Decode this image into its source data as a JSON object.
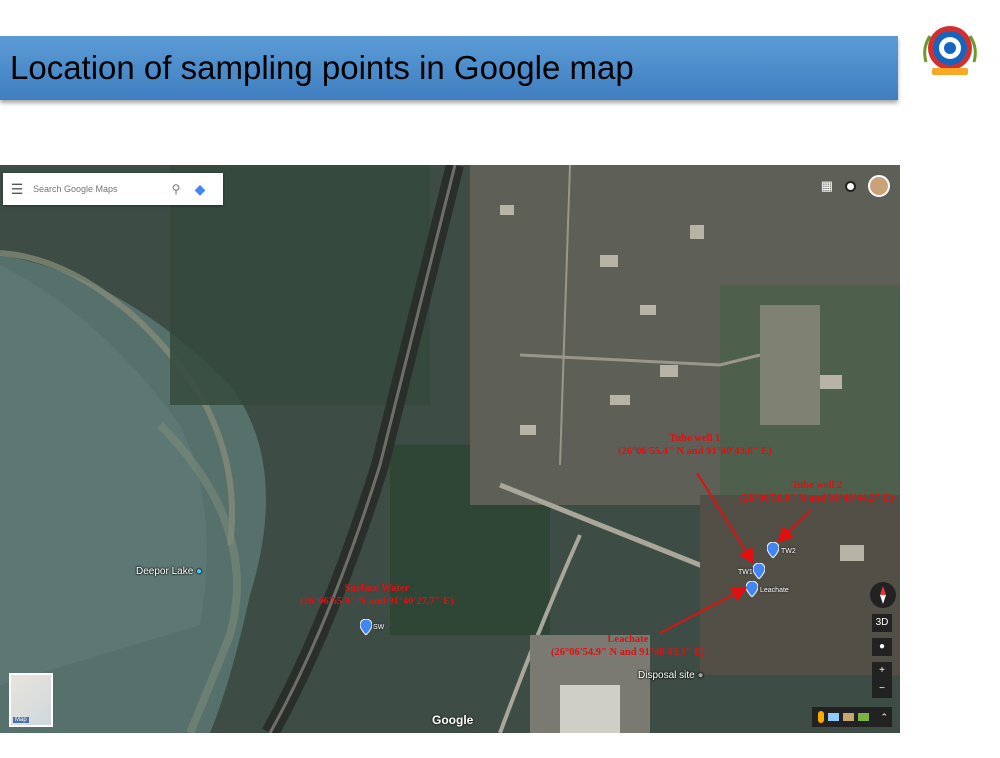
{
  "slide": {
    "title": "Location of sampling points in Google map"
  },
  "map": {
    "search": {
      "placeholder": "Search Google Maps"
    },
    "places": {
      "lake": "Deepor Lake",
      "disposal": "Disposal site"
    },
    "pins": [
      {
        "label": "SW"
      },
      {
        "label": "TW1"
      },
      {
        "label": "TW2"
      },
      {
        "label": "Leachate"
      }
    ],
    "annotations": {
      "tw1_title": "Tube well 1",
      "tw1_coord": "(26°06'55.4\" N and 91°40'43.6\" E)",
      "tw2_title": "Tube well 2",
      "tw2_coord": "(26°06'56.0\" N and 91°40'44.2\" E)",
      "sw_title": "Surface Water",
      "sw_coord": "(26°06'55.9\" N and 91°40'27.7\" E)",
      "leachate_title": "Leachate",
      "leachate_coord": "(26°06'54.9\" N and 91°40'43.3\" E)"
    },
    "thumbnail_label": "Map",
    "brand": "Google",
    "controls": {
      "tilt": "3D",
      "zoom_in": "+",
      "zoom_out": "−"
    },
    "colors": {
      "annotation": "#e01010",
      "pin": "#4285f4",
      "title_bar": "#5b9bd5"
    }
  }
}
